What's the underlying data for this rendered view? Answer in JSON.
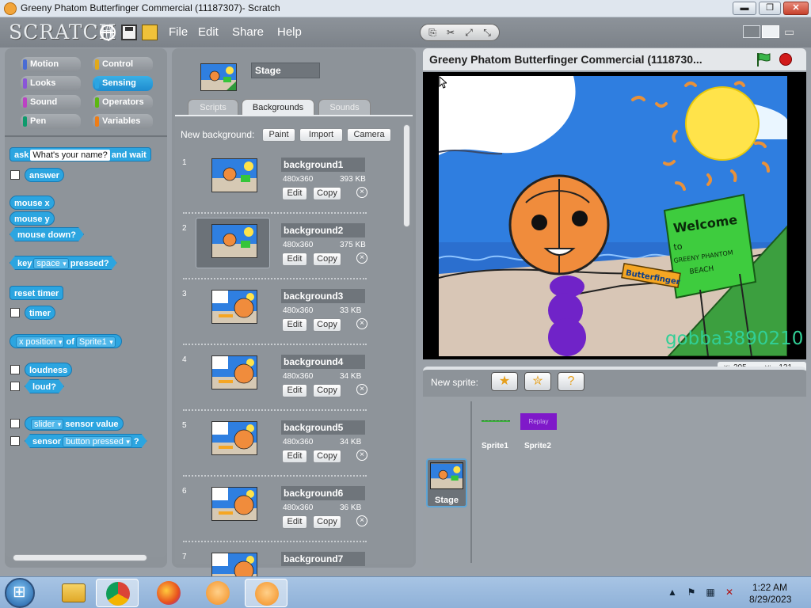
{
  "window": {
    "title": "Greeny Phatom Butterfinger Commercial (11187307)- Scratch",
    "minimize": "▬",
    "maximize": "❐",
    "close": "✕"
  },
  "menubar": {
    "logo": "SCRATCH",
    "menus": [
      "File",
      "Edit",
      "Share",
      "Help"
    ]
  },
  "categories": {
    "motion": "Motion",
    "looks": "Looks",
    "sound": "Sound",
    "pen": "Pen",
    "control": "Control",
    "sensing": "Sensing",
    "operators": "Operators",
    "variables": "Variables",
    "colors": {
      "motion": "#4a6cd4",
      "looks": "#8a55d7",
      "sound": "#bb42c3",
      "pen": "#0e9a6c",
      "control": "#e1a91a",
      "sensing": "#2ca5e2",
      "operators": "#5cb712",
      "variables": "#ee7d16"
    }
  },
  "blocks": {
    "ask": {
      "pre": "ask",
      "input": "What's your name?",
      "post": "and wait"
    },
    "answer": "answer",
    "mouse_x": "mouse x",
    "mouse_y": "mouse y",
    "mouse_down": "mouse down?",
    "key_pressed": {
      "pre": "key",
      "dropdown": "space",
      "post": "pressed?"
    },
    "reset_timer": "reset timer",
    "timer": "timer",
    "of": {
      "dropdown1": "x position",
      "mid": "of",
      "dropdown2": "Sprite1"
    },
    "loudness": "loudness",
    "loud": "loud?",
    "sensor_value": {
      "dropdown": "slider",
      "post": "sensor value"
    },
    "sensor": {
      "pre": "sensor",
      "dropdown": "button pressed",
      "post": "?"
    }
  },
  "editor": {
    "stage_name": "Stage",
    "tabs": [
      "Scripts",
      "Backgrounds",
      "Sounds"
    ],
    "new_background_label": "New background:",
    "buttons": {
      "paint": "Paint",
      "import": "Import",
      "camera": "Camera",
      "edit": "Edit",
      "copy": "Copy"
    },
    "delete_glyph": "×",
    "backgrounds": [
      {
        "num": "1",
        "name": "background1",
        "dims": "480x360",
        "size": "393 KB",
        "selected": false
      },
      {
        "num": "2",
        "name": "background2",
        "dims": "480x360",
        "size": "375 KB",
        "selected": true
      },
      {
        "num": "3",
        "name": "background3",
        "dims": "480x360",
        "size": "33 KB",
        "selected": false
      },
      {
        "num": "4",
        "name": "background4",
        "dims": "480x360",
        "size": "34 KB",
        "selected": false
      },
      {
        "num": "5",
        "name": "background5",
        "dims": "480x360",
        "size": "34 KB",
        "selected": false
      },
      {
        "num": "6",
        "name": "background6",
        "dims": "480x360",
        "size": "36 KB",
        "selected": false
      },
      {
        "num": "7",
        "name": "background7",
        "dims": "",
        "size": "",
        "selected": false
      }
    ]
  },
  "stage": {
    "project_title": "Greeny Phatom Butterfinger Commercial (1118730...",
    "watermark": "gobba3890210",
    "sign_text": {
      "line1": "Welcome",
      "line2": "to",
      "line3": "GREENY PHANTOM",
      "line4": "BEACH"
    },
    "bar_text": "Butterfinger",
    "coords": {
      "x_label": "x:",
      "x": "205",
      "y_label": "y:",
      "y": "-121"
    }
  },
  "sprites": {
    "new_sprite_label": "New sprite:",
    "stage_label": "Stage",
    "items": [
      {
        "name": "Sprite1"
      },
      {
        "name": "Sprite2",
        "thumb_text": "Replay"
      }
    ]
  },
  "taskbar": {
    "time": "1:22 AM",
    "date": "8/29/2023"
  }
}
